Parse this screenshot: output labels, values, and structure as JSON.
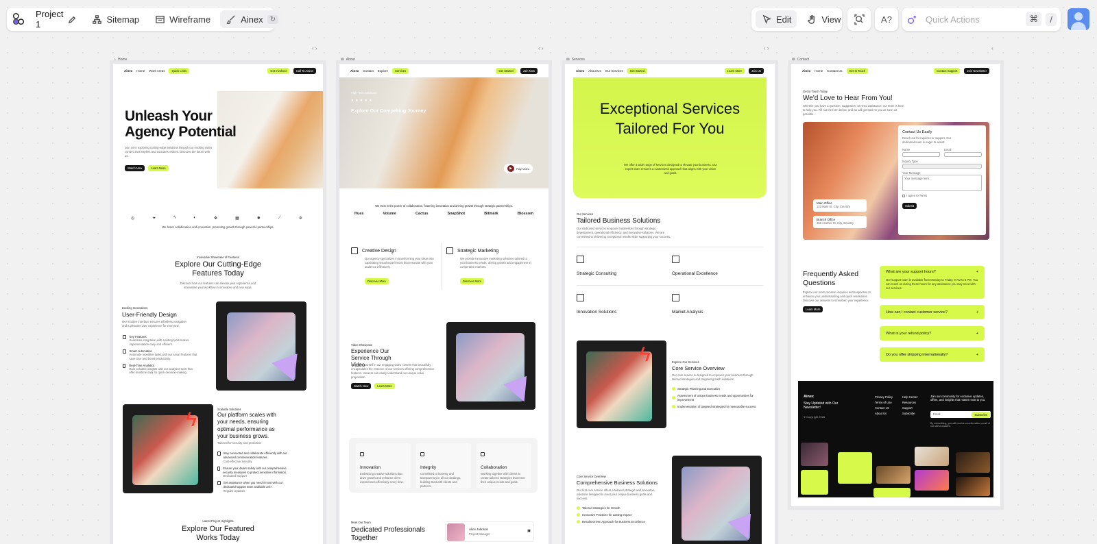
{
  "toolbar": {
    "project_name": "Project 1",
    "tabs": [
      "Sitemap",
      "Wireframe",
      "Ainex"
    ],
    "mode_edit": "Edit",
    "mode_view": "View",
    "search_placeholder": "Quick Actions",
    "shortcut_cmd": "⌘",
    "shortcut_slash": "/"
  },
  "icons": [
    "logo-icon",
    "pencil-icon",
    "sitemap-icon",
    "wireframe-icon",
    "brush-icon",
    "cursor-icon",
    "hand-icon",
    "scan-icon",
    "ai-text-icon",
    "sparkle-icon",
    "avatar-icon"
  ],
  "colors": {
    "accent": "#d6f94a",
    "dark": "#161616",
    "canvas": "#f1f1f2",
    "user_avatar": "#5b8def"
  },
  "home": {
    "tab": "Home",
    "nav": {
      "brand": "Ainex",
      "links": [
        "Home",
        "Work Areas"
      ],
      "quick": "Quick Links",
      "btn1": "Get Involved",
      "btn2": "Call To Action"
    },
    "hero_title": "Unleash Your Agency Potential",
    "hero_text": "Join us in exploring cutting-edge solutions through our exciting video content that inspires and educates visitors. Discover the future with us.",
    "watch": "Watch Now",
    "learn": "Learn More",
    "partners_text": "We foster collaboration and innovation, promoting growth through powerful partnerships.",
    "kicker": "Innovative Showcase of Features",
    "features_title": "Explore Our Cutting-Edge Features Today",
    "features_text": "Discover how our features can elevate your experience and streamline your workflow in innovative and new ways.",
    "ux_kicker": "Exciting Innovations",
    "ux_title": "User-Friendly Design",
    "ux_text": "Our intuitive interface ensures effortless navigation and a pleasant user experience for everyone.",
    "ux_items": [
      {
        "t": "Key Features",
        "d": "Seamless integration with existing tools makes implementation easy and efficient."
      },
      {
        "t": "Smart Automation",
        "d": "Automate repetitive tasks with our smart features that save time and boost productivity."
      },
      {
        "t": "Real-Time Analytics",
        "d": "Gain valuable insights with our analytics tools that offer real-time data for quick decision-making."
      }
    ],
    "sc_kicker": "Scalable Solutions",
    "sc_title": "Our platform scales with your needs, ensuring optimal performance as your business grows.",
    "sc_sub": "Tailored for security and protection",
    "sc_items": [
      "Stay connected and collaborate efficiently with our advanced communication features.",
      "Ensure your data's safety with our comprehensive security measures to protect sensitive information.",
      "Get assistance when you need it most with our dedicated support team available 24/7."
    ],
    "sc_item_subs": [
      "Cost-effective Security",
      "Dedicated Support",
      "Regular Updates"
    ],
    "proj_kicker": "Latest Project Highlights",
    "proj_title": "Explore Our Featured Works Today"
  },
  "about": {
    "tab": "About",
    "nav": {
      "brand": "Ainex",
      "links": [
        "Contact",
        "Explore"
      ],
      "quick": "Services",
      "btn1": "Get Started",
      "btn2": "Join Now"
    },
    "hero_kicker": "High-Tech Solutions",
    "hero_title": "Explore Our Compelling Journey",
    "video": "Play Video",
    "trust_text": "We trust in the power of collaboration, fostering innovation and driving growth through strategic partnerships.",
    "logos": [
      "Hues",
      "Volume",
      "Cactus",
      "SnapShot",
      "Bitmark",
      "Blossom"
    ],
    "cards": [
      {
        "t": "Creative Design",
        "d": "Our agency specializes in transforming your ideas into captivating visual experiences that resonate with your audience effectively.",
        "b": "Discover More"
      },
      {
        "t": "Strategic Marketing",
        "d": "We provide innovative marketing solutions tailored to your business needs, driving growth and engagement in competitive markets.",
        "b": "Discover More"
      }
    ],
    "vid_kicker": "Video Showcase",
    "vid_title": "Experience Our Service Through Video",
    "vid_text": "Immerse yourself in our engaging video content that beautifully encapsulates the essence of our services offering comprehensive features. Viewers can easily understand our unique value proposition.",
    "watch": "Watch Now",
    "learn": "Learn More",
    "values": [
      {
        "t": "Innovation",
        "d": "Embracing creative solutions that drive growth and enhance client experiences effectively every time."
      },
      {
        "t": "Integrity",
        "d": "Committed to honesty and transparency in all our dealings, building trust with clients and partners."
      },
      {
        "t": "Collaboration",
        "d": "Working together with clients to create tailored strategies that meet their unique needs and goals."
      }
    ],
    "team_kicker": "Meet Our Team",
    "team_title": "Dedicated Professionals Together",
    "member_name": "Alice Johnson",
    "member_role": "Project Manager"
  },
  "services": {
    "tab": "Services",
    "nav": {
      "brand": "Ainex",
      "links": [
        "About Us",
        "Our Services"
      ],
      "quick": "Get Started",
      "btn1": "Learn More",
      "btn2": "Join Us"
    },
    "hero_title": "Exceptional Services Tailored For You",
    "hero_text": "We offer a wide range of services designed to elevate your business. Our expert team ensures a customized approach that aligns with your vision and goals.",
    "kicker": "Our Services",
    "title": "Tailored Business Solutions",
    "text": "Our dedicated services empower businesses through strategic development, operational efficiency, and innovative solutions. We are committed to delivering exceptional results while supporting your success.",
    "grid": [
      "Strategic Consulting",
      "Operational Excellence",
      "Innovation Solutions",
      "Market Analysis"
    ],
    "core_kicker": "Explore Our Services",
    "core_title": "Core Service Overview",
    "core_text": "Our core service is designed to empower your business through tailored strategies and targeted growth initiatives.",
    "core_items": [
      "Strategic Planning and Execution",
      "Assessment of unique business needs and opportunities for improvement",
      "Implementation of targeted strategies for measurable success"
    ],
    "comp_kicker": "Core Service Overview",
    "comp_title": "Comprehensive Business Solutions",
    "comp_text": "Our first core service offers a tailored strategic and innovative solutions designed to meet your unique business goals and success.",
    "comp_items": [
      "Tailored Strategies for Growth",
      "Innovative Practices for Lasting Impact",
      "Results-Driven Approach for Business Excellence"
    ]
  },
  "contact": {
    "tab": "Contact",
    "nav": {
      "brand": "Ainex",
      "links": [
        "Home",
        "Contact Us"
      ],
      "quick": "Get In Touch",
      "btn1": "Contact Support",
      "btn2": "Join Newsletter"
    },
    "kicker": "Get In Touch Today",
    "title": "We'd Love to Hear From You!",
    "text": "Whether you have a question, suggestion, or need assistance, our team is here to help you. Fill out the form below, and we will get back to you as soon as possible.",
    "form_title": "Contact Us Easily",
    "form_text": "Reach out for inquiries or support. Our dedicated team is eager to assist.",
    "fields": [
      "Name",
      "Email",
      "Inquiry Type",
      "Your Message"
    ],
    "message_placeholder": "Your message here...",
    "agree": "I agree to Terms",
    "submit": "Submit",
    "offices": [
      {
        "t": "Main Office",
        "d": "123 Main St, City, Country"
      },
      {
        "t": "Branch Office",
        "d": "456 Another St, City, Country"
      }
    ],
    "faq_title": "Frequently Asked Questions",
    "faq_text": "Explore our most common inquiries and responses to enhance your understanding and quick resolutions. Discover our answers to smoothen your experience.",
    "faq_btn": "Learn More",
    "faq": [
      {
        "q": "What are your support hours?",
        "a": "Our support team is available from Monday to Friday, 9 AM to 5 PM. You can reach us during these hours for any assistance you may need with our services."
      },
      {
        "q": "How can I contact customer service?"
      },
      {
        "q": "What is your refund policy?"
      },
      {
        "q": "Do you offer shipping internationally?"
      }
    ],
    "footer": {
      "brand": "Ainex",
      "tagline": "Stay Updated with Our Newsletter!",
      "copy": "© Copyright 2026",
      "col1": [
        "Privacy Policy",
        "Terms of Use",
        "Contact Us",
        "About Us"
      ],
      "col2": [
        "Help Center",
        "Resources",
        "Support",
        "Subscribe"
      ],
      "join": "Join our community for exclusive updates, offers, and insights that matter most to you.",
      "email": "Email",
      "subscribe": "Subscribe",
      "note": "By subscribing, you will receive a confirmation email of our latest updates."
    }
  }
}
